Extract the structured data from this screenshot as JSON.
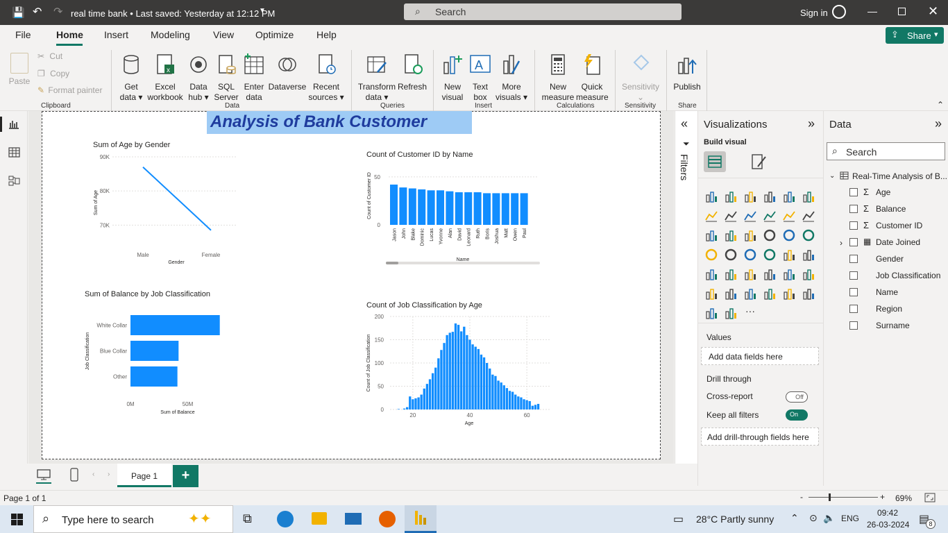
{
  "titlebar": {
    "doc_title": "real time bank",
    "saved": "Last saved: Yesterday at 12:12 PM",
    "search_placeholder": "Search",
    "sign_in": "Sign in"
  },
  "menu": [
    "File",
    "Home",
    "Insert",
    "Modeling",
    "View",
    "Optimize",
    "Help"
  ],
  "share": "Share",
  "ribbon": {
    "clipboard": {
      "paste": "Paste",
      "cut": "Cut",
      "copy": "Copy",
      "format_painter": "Format painter",
      "group": "Clipboard"
    },
    "data": {
      "items": [
        {
          "l1": "Get",
          "l2": "data ▾"
        },
        {
          "l1": "Excel",
          "l2": "workbook"
        },
        {
          "l1": "Data",
          "l2": "hub ▾"
        },
        {
          "l1": "SQL",
          "l2": "Server"
        },
        {
          "l1": "Enter",
          "l2": "data"
        },
        {
          "l1": "Dataverse",
          "l2": ""
        },
        {
          "l1": "Recent",
          "l2": "sources ▾"
        }
      ],
      "group": "Data"
    },
    "queries": {
      "transform_1": "Transform",
      "transform_2": "data ▾",
      "refresh": "Refresh",
      "group": "Queries"
    },
    "insert": {
      "new_visual_1": "New",
      "new_visual_2": "visual",
      "text_box_1": "Text",
      "text_box_2": "box",
      "more_1": "More",
      "more_2": "visuals ▾",
      "group": "Insert"
    },
    "calculations": {
      "new_measure_1": "New",
      "new_measure_2": "measure",
      "quick_1": "Quick",
      "quick_2": "measure",
      "group": "Calculations"
    },
    "sensitivity": {
      "label": "Sensitivity",
      "group": "Sensitivity"
    },
    "share_group": {
      "publish": "Publish",
      "group": "Share"
    }
  },
  "report": {
    "title": "Analysis of Bank Customer",
    "charts": [
      {
        "title": "Sum of Age by Gender"
      },
      {
        "title": "Count of Customer ID by Name"
      },
      {
        "title": "Sum of Balance by Job Classification"
      },
      {
        "title": "Count of Job Classification by Age"
      }
    ]
  },
  "chart_data": [
    {
      "type": "line",
      "title": "Sum of Age by Gender",
      "categories": [
        "Male",
        "Female"
      ],
      "values": [
        87000,
        68500
      ],
      "xlabel": "Gender",
      "ylabel": "Sum of Age",
      "yticks": [
        "90K",
        "80K",
        "70K"
      ],
      "ylim": [
        66000,
        90000
      ],
      "color": "#118dff"
    },
    {
      "type": "bar",
      "title": "Count of Customer ID by Name",
      "categories": [
        "Jason",
        "John",
        "Blake",
        "Dominic",
        "Lucas",
        "Yvonne",
        "Alan",
        "David",
        "Leonard",
        "Ruth",
        "Boris",
        "Joshua",
        "Matt",
        "Owen",
        "Paul"
      ],
      "values": [
        42,
        39,
        38,
        37,
        36,
        36,
        35,
        34,
        34,
        34,
        33,
        33,
        33,
        33,
        33
      ],
      "xlabel": "Name",
      "ylabel": "Count of Customer ID",
      "yticks": [
        "50",
        "0"
      ],
      "ylim": [
        0,
        55
      ],
      "color": "#118dff"
    },
    {
      "type": "bar",
      "orientation": "horizontal",
      "title": "Sum of Balance by Job Classification",
      "categories": [
        "White Collar",
        "Blue Collar",
        "Other"
      ],
      "values": [
        78,
        42,
        41
      ],
      "xlabel": "Sum of Balance",
      "ylabel": "Job Classification",
      "xticks": [
        "0M",
        "50M"
      ],
      "xlim": [
        0,
        80
      ],
      "color": "#118dff"
    },
    {
      "type": "bar",
      "title": "Count of Job Classification by Age",
      "x": [
        15,
        16,
        17,
        18,
        19,
        20,
        21,
        22,
        23,
        24,
        25,
        26,
        27,
        28,
        29,
        30,
        31,
        32,
        33,
        34,
        35,
        36,
        37,
        38,
        39,
        40,
        41,
        42,
        43,
        44,
        45,
        46,
        47,
        48,
        49,
        50,
        51,
        52,
        53,
        54,
        55,
        56,
        57,
        58,
        59,
        60,
        61,
        62,
        63,
        64
      ],
      "values": [
        1,
        0,
        2,
        5,
        28,
        22,
        24,
        26,
        32,
        45,
        55,
        65,
        78,
        90,
        110,
        128,
        143,
        160,
        165,
        167,
        185,
        182,
        168,
        178,
        160,
        150,
        140,
        135,
        130,
        118,
        112,
        100,
        88,
        75,
        72,
        62,
        58,
        52,
        46,
        40,
        38,
        32,
        28,
        26,
        22,
        20,
        18,
        8,
        10,
        12
      ],
      "xlabel": "Age",
      "ylabel": "Count of Job Classification",
      "yticks": [
        "200",
        "150",
        "100",
        "50",
        "0"
      ],
      "xticks": [
        "20",
        "40",
        "60"
      ],
      "ylim": [
        0,
        200
      ],
      "xlim": [
        12,
        68
      ],
      "color": "#118dff"
    }
  ],
  "filters_label": "Filters",
  "viz": {
    "title": "Visualizations",
    "build": "Build visual",
    "values_label": "Values",
    "values_placeholder": "Add data fields here",
    "drill": "Drill through",
    "cross_report": "Cross-report",
    "cross_state": "Off",
    "keep_filters": "Keep all filters",
    "keep_state": "On",
    "drill_placeholder": "Add drill-through fields here",
    "more": "···"
  },
  "data_pane": {
    "title": "Data",
    "search": "Search",
    "table": "Real-Time Analysis of B...",
    "fields": [
      {
        "name": "Age",
        "sigma": "Σ"
      },
      {
        "name": "Balance",
        "sigma": "Σ"
      },
      {
        "name": "Customer ID",
        "sigma": "Σ"
      },
      {
        "name": "Date Joined",
        "sigma": ""
      },
      {
        "name": "Gender",
        "sigma": ""
      },
      {
        "name": "Job Classification",
        "sigma": ""
      },
      {
        "name": "Name",
        "sigma": ""
      },
      {
        "name": "Region",
        "sigma": ""
      },
      {
        "name": "Surname",
        "sigma": ""
      }
    ]
  },
  "pages": {
    "tab": "Page 1",
    "add": "+"
  },
  "status": {
    "page": "Page 1 of 1",
    "zoom": "69%",
    "minus": "-",
    "plus": "+"
  },
  "taskbar": {
    "search": "Type here to search",
    "weather": "28°C  Partly sunny",
    "lang": "ENG",
    "time": "09:42",
    "date": "26-03-2024",
    "notif": "8"
  }
}
